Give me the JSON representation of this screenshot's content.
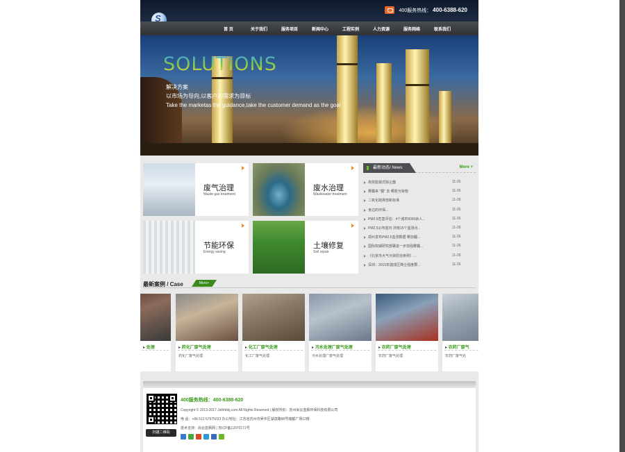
{
  "header": {
    "hotline_label": "400服务热线：",
    "hotline_number": "400-6388-620",
    "logo_tag": "SUYUNJIXIE"
  },
  "nav": {
    "items": [
      "首 页",
      "关于我们",
      "服务项目",
      "新闻中心",
      "工程实例",
      "人力资源",
      "服务网络",
      "联系我们"
    ]
  },
  "banner": {
    "title": "SOLUTIONS",
    "line1": "解决方案",
    "line2": "以市场为导向,以客户的需求为目标",
    "line3": "Take the marketas the guidance,take the customer demand as the goal"
  },
  "services": [
    {
      "zh": "废气治理",
      "en": "Waste gas treatment"
    },
    {
      "zh": "废水治理",
      "en": "Wastewater treatment"
    },
    {
      "zh": "节能环保",
      "en": "Energy saving"
    },
    {
      "zh": "土壤修复",
      "en": "Soil repair"
    }
  ],
  "news": {
    "title": "最新动态/ News",
    "more": "More +",
    "items": [
      {
        "title": "高效能袋式除尘器",
        "date": "11-26"
      },
      {
        "title": "雾霾来 \"霾\" 去 哪些污染物",
        "date": "11-26"
      },
      {
        "title": "二氧化硫排放新标准",
        "date": "11-26"
      },
      {
        "title": "身边的环保...",
        "date": "11-26"
      },
      {
        "title": "PM2.5危害评估：4个城市8000余人...",
        "date": "11-26"
      },
      {
        "title": "PM2.5公布首日 济南15个监测点...",
        "date": "11-26"
      },
      {
        "title": "郑州发布PM2.5监测数据 雾加霾...",
        "date": "11-26"
      },
      {
        "title": "国际权威研究部署进一步加强雾霾...",
        "date": "11-26"
      },
      {
        "title": "《北京市大气污染防治条例》...",
        "date": "11-26"
      },
      {
        "title": "深圳：2015年建成区降尘强度要...",
        "date": "11-26"
      }
    ]
  },
  "cases": {
    "title": "最新案例 / Case",
    "more": "More+",
    "items": [
      {
        "name": "处理",
        "sub": ""
      },
      {
        "name": "药化厂废气处理",
        "sub": "药化厂废气处理"
      },
      {
        "name": "化工厂废气处理",
        "sub": "化工厂废气处理"
      },
      {
        "name": "污水处理厂废气处理",
        "sub": "污水处理厂废气处理"
      },
      {
        "name": "农药厂废气处理",
        "sub": "农药厂废气处理"
      },
      {
        "name": "农药厂废气",
        "sub": "农药厂废气处"
      }
    ]
  },
  "footer": {
    "hotline": "400服务热线：400-6388-620",
    "copyright": "Copyright © 2013-2017 Jsthhbkj.com All Rights Reserved | 版权所有：苏州尚云蓝枫环保科技有限公司",
    "contact": "电 话：+86 512 67975033 办公地址：江苏省苏州市吴中区湖滨路88号瑞都广场12楼",
    "support": "技术支持：尚云蓝枫网 | 苏ICP备12070171号",
    "qr_label": "扫描二维码"
  },
  "colors": {
    "accent_green": "#3a9a1c",
    "accent_orange": "#e86a18",
    "nav_bg": "#3a3c40"
  }
}
